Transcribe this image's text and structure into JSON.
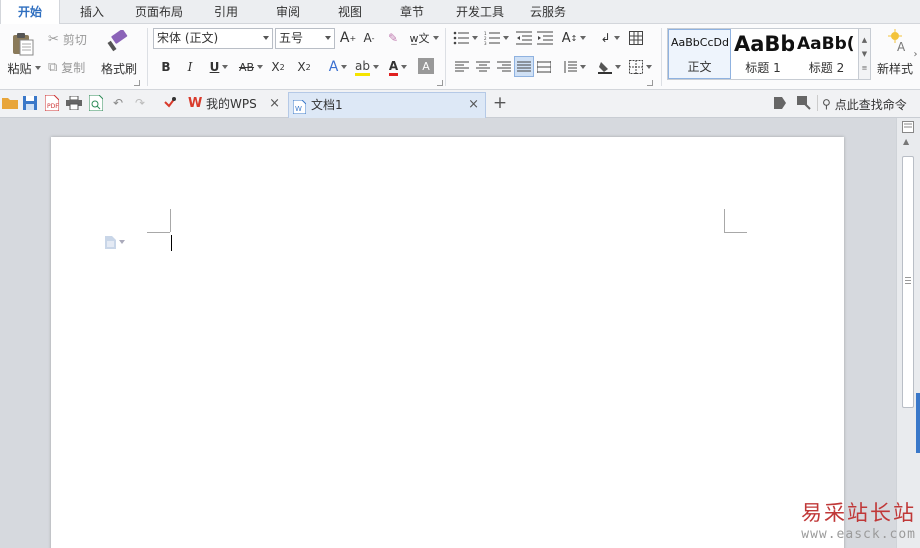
{
  "menu": {
    "tabs": [
      "开始",
      "插入",
      "页面布局",
      "引用",
      "审阅",
      "视图",
      "章节",
      "开发工具",
      "云服务"
    ],
    "active": "开始"
  },
  "ribbon": {
    "clipboard": {
      "paste": "粘贴",
      "cut": "剪切",
      "copy": "复制",
      "format_painter": "格式刷"
    },
    "font": {
      "family": "宋体 (正文)",
      "size": "五号"
    },
    "styles": {
      "items": [
        {
          "preview": "AaBbCcDd",
          "name": "正文"
        },
        {
          "preview": "AaBb",
          "name": "标题 1"
        },
        {
          "preview": "AaBb(",
          "name": "标题 2"
        }
      ],
      "new_style": "新样式"
    }
  },
  "quickbar": {
    "tabs": [
      {
        "label": "我的WPS"
      },
      {
        "label": "文档1"
      }
    ],
    "search": "点此查找命令"
  },
  "colors": {
    "accent_blue": "#2f6fc0",
    "font_color_underline": "#e02020",
    "highlight_color": "#f5e400",
    "wps_red": "#d93a2b",
    "watermark_red": "#c03838"
  },
  "watermark": {
    "title": "易采站长站",
    "url": "www.easck.com"
  }
}
